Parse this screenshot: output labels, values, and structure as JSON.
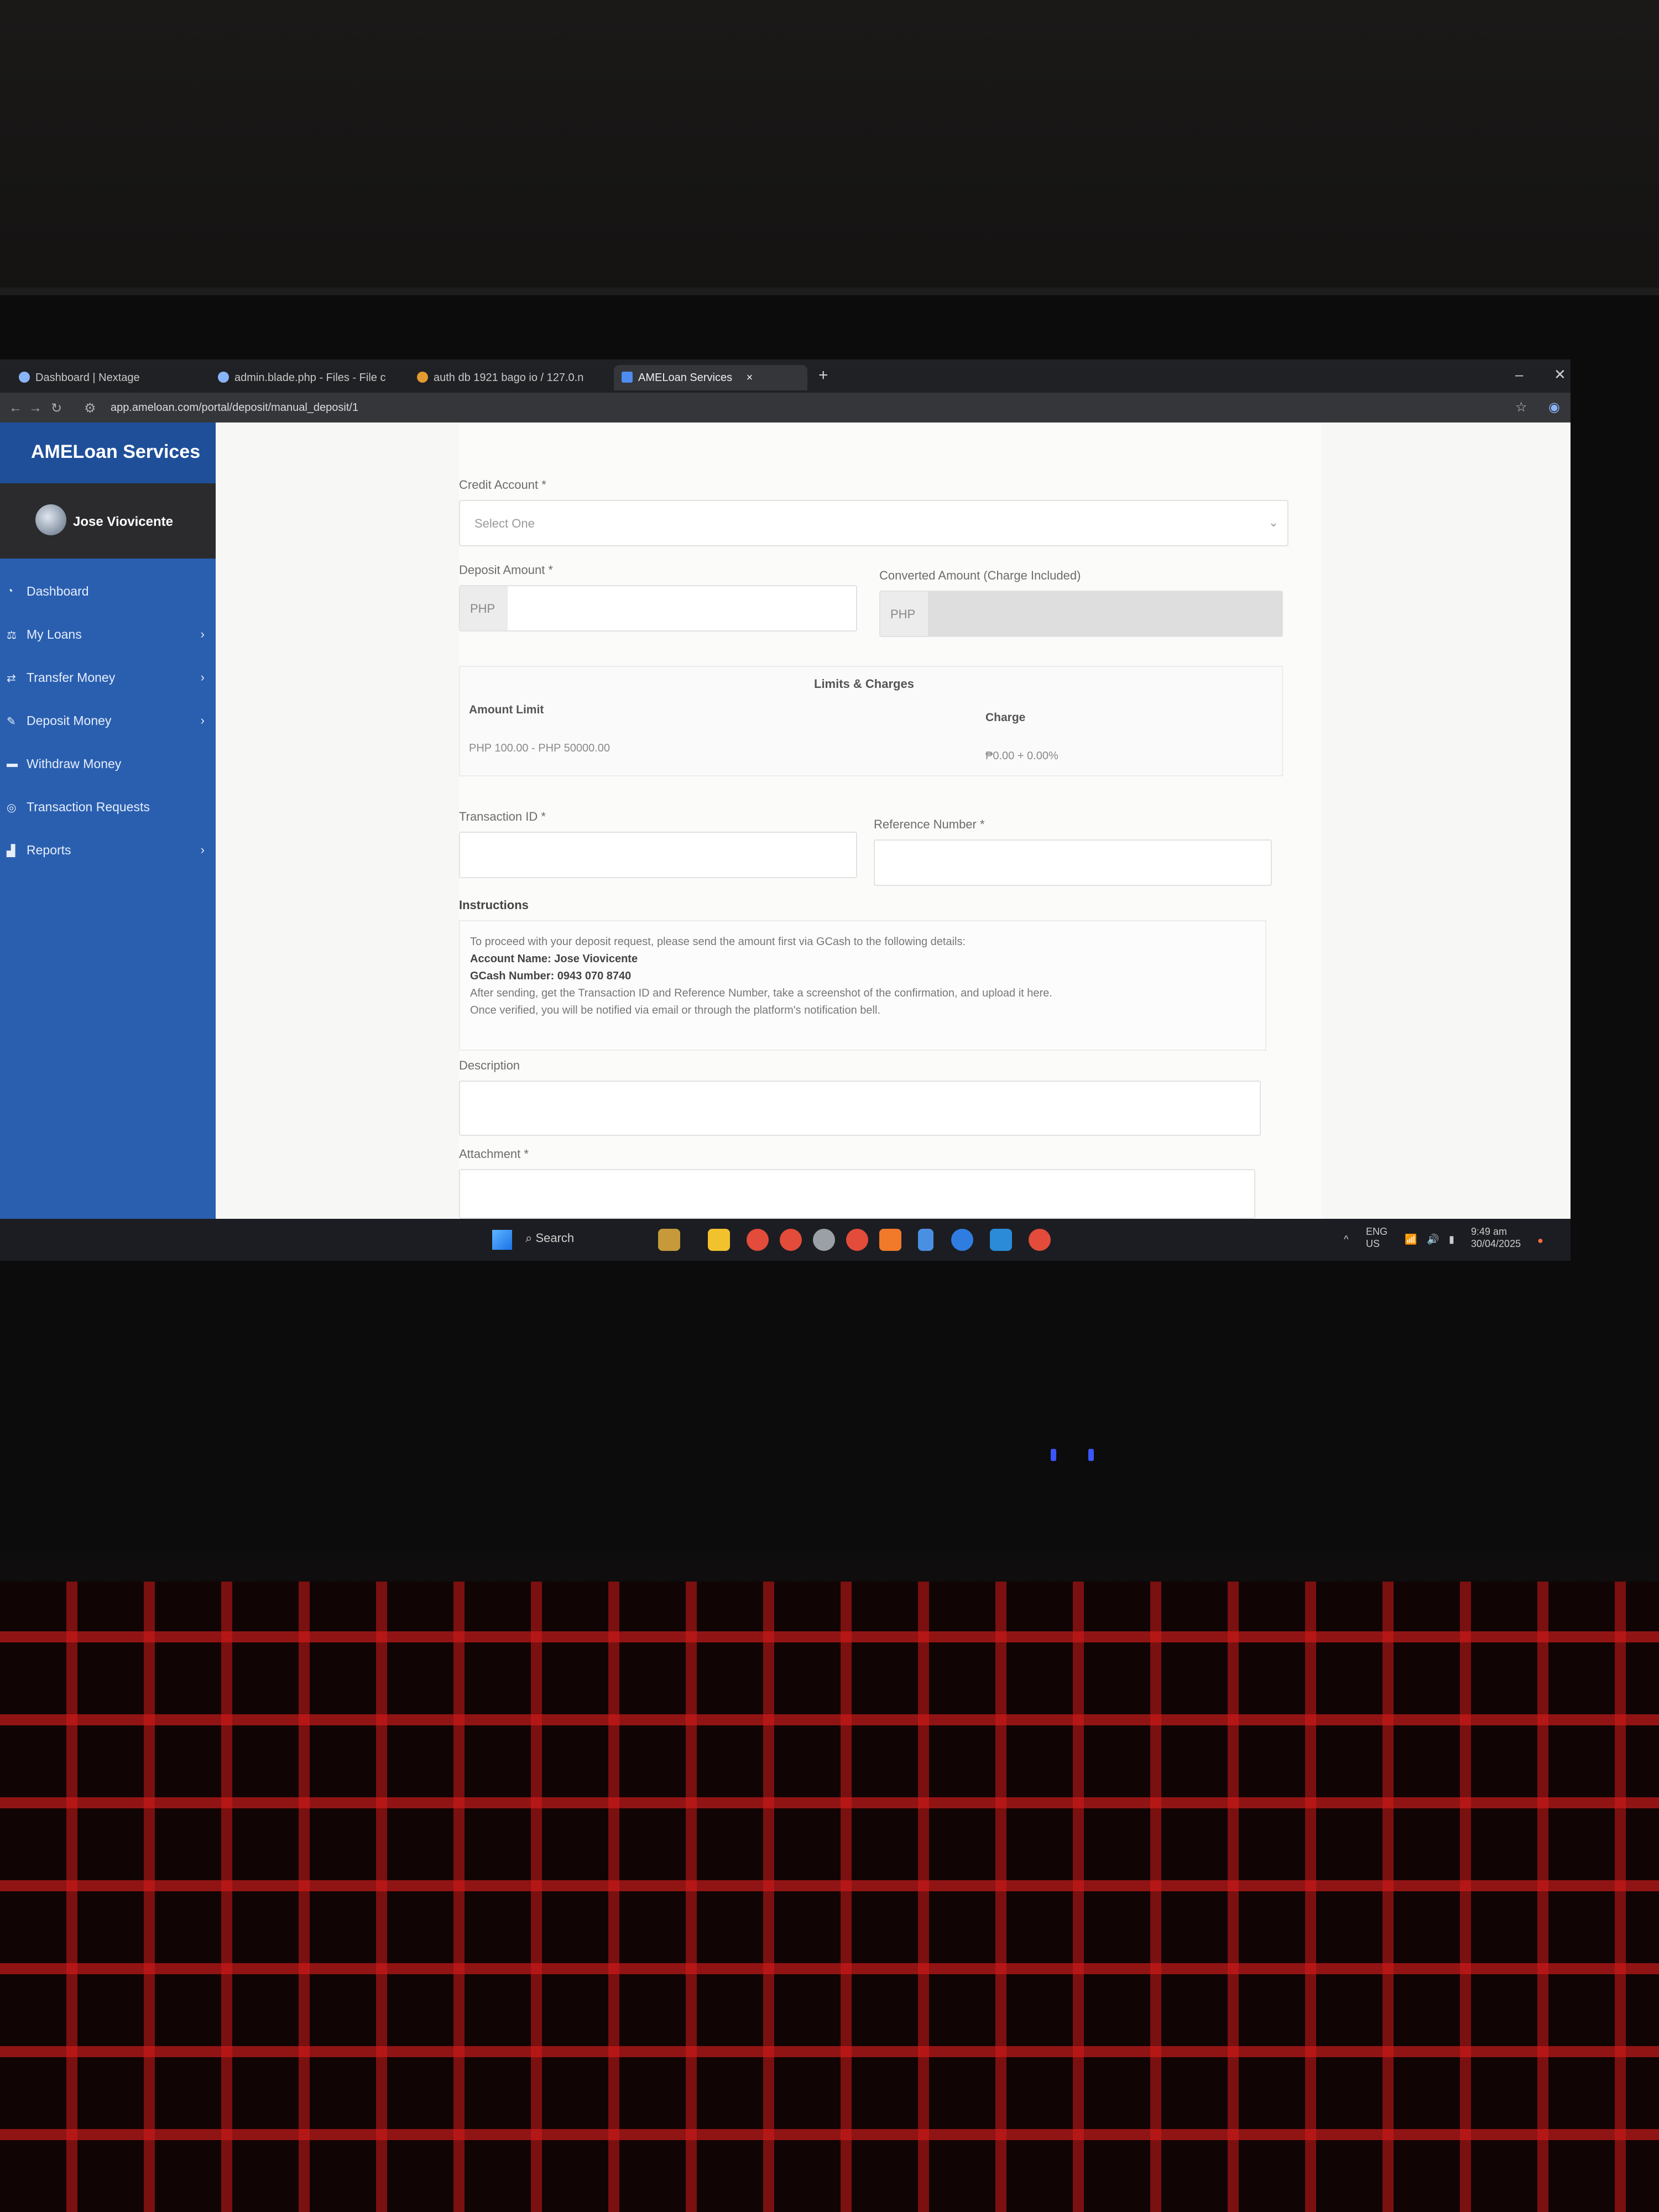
{
  "browser": {
    "tabs": [
      {
        "label": "Dashboard | Nextage",
        "active": false
      },
      {
        "label": "admin.blade.php - Files - File c",
        "active": false
      },
      {
        "label": "auth db 1921 bago io / 127.0.n",
        "active": false
      },
      {
        "label": "AMELoan Services",
        "active": true
      }
    ],
    "close_symbol": "×",
    "new_tab_symbol": "+",
    "url": "app.ameloan.com/portal/deposit/manual_deposit/1"
  },
  "sidebar": {
    "brand": "AMELoan Services",
    "user_name": "Jose Viovicente",
    "items": [
      {
        "label": "Dashboard",
        "icon": "dashboard-icon",
        "has_submenu": false
      },
      {
        "label": "My Loans",
        "icon": "loans-icon",
        "has_submenu": true
      },
      {
        "label": "Transfer Money",
        "icon": "transfer-icon",
        "has_submenu": true
      },
      {
        "label": "Deposit Money",
        "icon": "deposit-icon",
        "has_submenu": true
      },
      {
        "label": "Withdraw Money",
        "icon": "withdraw-icon",
        "has_submenu": false
      },
      {
        "label": "Transaction Requests",
        "icon": "requests-icon",
        "has_submenu": false
      },
      {
        "label": "Reports",
        "icon": "reports-icon",
        "has_submenu": true
      }
    ]
  },
  "form": {
    "credit_account_label": "Credit Account *",
    "credit_account_value": "Select One",
    "deposit_amount_label": "Deposit Amount *",
    "converted_amount_label": "Converted Amount (Charge Included)",
    "currency_prefix": "PHP",
    "limits_title": "Limits & Charges",
    "amount_limit_header": "Amount Limit",
    "charge_header": "Charge",
    "amount_limit_value": "PHP 100.00 - PHP 50000.00",
    "charge_value": "₱0.00 + 0.00%",
    "transaction_id_label": "Transaction ID *",
    "reference_number_label": "Reference Number *",
    "instructions_title": "Instructions",
    "instructions_line1": "To proceed with your deposit request, please send the amount first via GCash to the following details:",
    "account_name_line": "Account Name: Jose Viovicente",
    "gcash_number_line": "GCash Number: 0943 070 8740",
    "instructions_line2": "After sending, get the Transaction ID and Reference Number, take a screenshot of the confirmation, and upload it here.",
    "instructions_line3": "Once verified, you will be notified via email or through the platform's notification bell.",
    "description_label": "Description",
    "attachment_label": "Attachment *"
  },
  "taskbar": {
    "search_label": "Search",
    "language": "ENG",
    "region": "US",
    "time": "9:49 am",
    "date": "30/04/2025"
  },
  "colors": {
    "sidebar": "#2a5fb0",
    "brand_bar": "#1f4f99",
    "keyboard_backlight": "#e01e1e"
  }
}
